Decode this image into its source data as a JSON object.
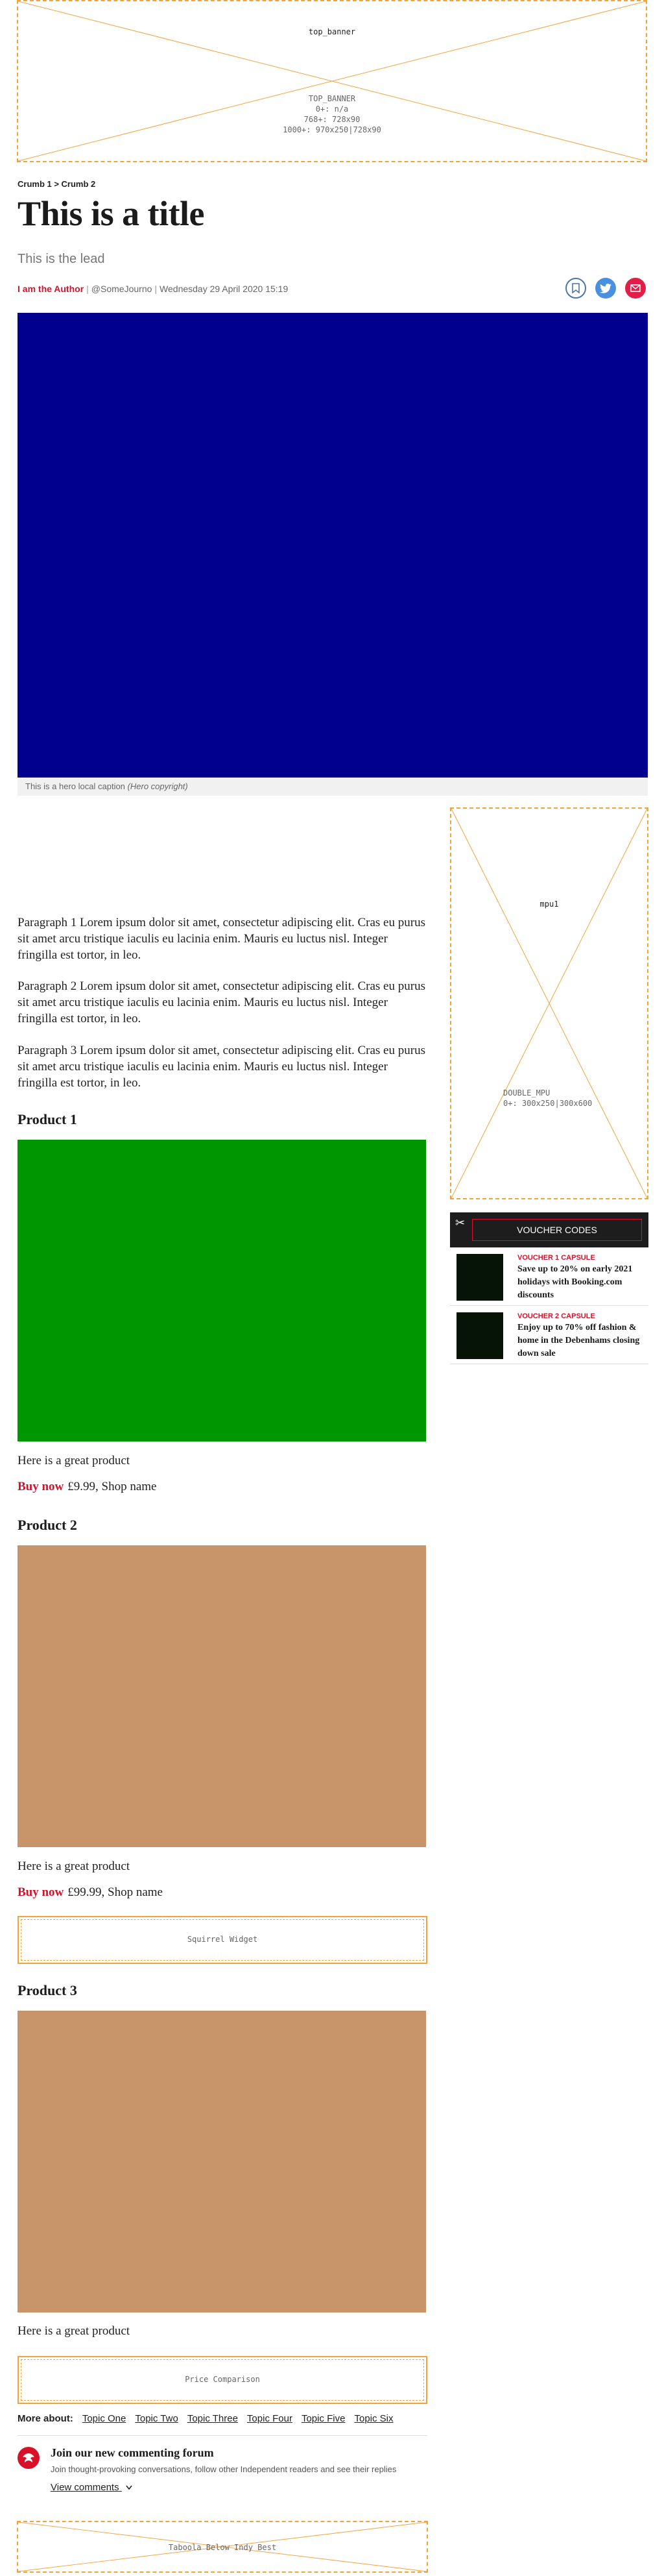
{
  "top_banner": {
    "name": "top_banner",
    "meta": [
      "TOP_BANNER",
      "0+: n/a",
      "768+: 728x90",
      "1000+: 970x250|728x90"
    ]
  },
  "breadcrumb": "Crumb 1 > Crumb 2",
  "article": {
    "title": "This is a title",
    "lead": "This is the lead",
    "author": "I am the Author",
    "handle": "@SomeJourno",
    "date": "Wednesday 29 April 2020 15:19",
    "hero_caption": "This is a hero local caption",
    "hero_copyright": "(Hero copyright)",
    "hero_color": "#01008e"
  },
  "share": {
    "bookmark_icon": "bookmark-icon",
    "twitter_icon": "twitter-icon",
    "email_icon": "email-icon"
  },
  "paragraphs": [
    "Paragraph 1 Lorem ipsum dolor sit amet, consectetur adipiscing elit. Cras eu purus sit amet arcu tristique iaculis eu lacinia enim. Mauris eu luctus nisl. Integer fringilla est tortor, in leo.",
    "Paragraph 2 Lorem ipsum dolor sit amet, consectetur adipiscing elit. Cras eu purus sit amet arcu tristique iaculis eu lacinia enim. Mauris eu luctus nisl. Integer fringilla est tortor, in leo.",
    "Paragraph 3 Lorem ipsum dolor sit amet, consectetur adipiscing elit. Cras eu purus sit amet arcu tristique iaculis eu lacinia enim. Mauris eu luctus nisl. Integer fringilla est tortor, in leo."
  ],
  "products": [
    {
      "title": "Product 1",
      "color": "#009600",
      "desc": "Here is a great product",
      "buy": "Buy now",
      "price": "£9.99, Shop name"
    },
    {
      "title": "Product 2",
      "color": "#c8956a",
      "desc": "Here is a great product",
      "buy": "Buy now",
      "price": "£99.99, Shop name"
    },
    {
      "title": "Product 3",
      "color": "#c8956a",
      "desc": "Here is a great product"
    }
  ],
  "widgets": {
    "squirrel": "Squirrel Widget",
    "price_comparison": "Price Comparison",
    "taboola": "Taboola Below Indy Best"
  },
  "mpu": {
    "name": "mpu1",
    "meta": [
      "DOUBLE_MPU",
      "0+: 300x250|300x600"
    ]
  },
  "vouchers": {
    "header": "VOUCHER CODES",
    "items": [
      {
        "kicker": "VOUCHER 1 CAPSULE",
        "title": "Save up to 20% on early 2021 holidays with Booking.com discounts"
      },
      {
        "kicker": "VOUCHER 2 CAPSULE",
        "title": "Enjoy up to 70% off fashion & home in the Debenhams closing down sale"
      }
    ]
  },
  "more_about": {
    "label": "More about:",
    "topics": [
      "Topic One",
      "Topic Two",
      "Topic Three",
      "Topic Four",
      "Topic Five",
      "Topic Six"
    ]
  },
  "forum": {
    "title": "Join our new commenting forum",
    "subtitle": "Join thought-provoking conversations, follow other Independent readers and see their replies",
    "view_comments": "View comments"
  },
  "colors": {
    "brand_red": "#d8112b",
    "ad_border": "#f3a33a"
  }
}
